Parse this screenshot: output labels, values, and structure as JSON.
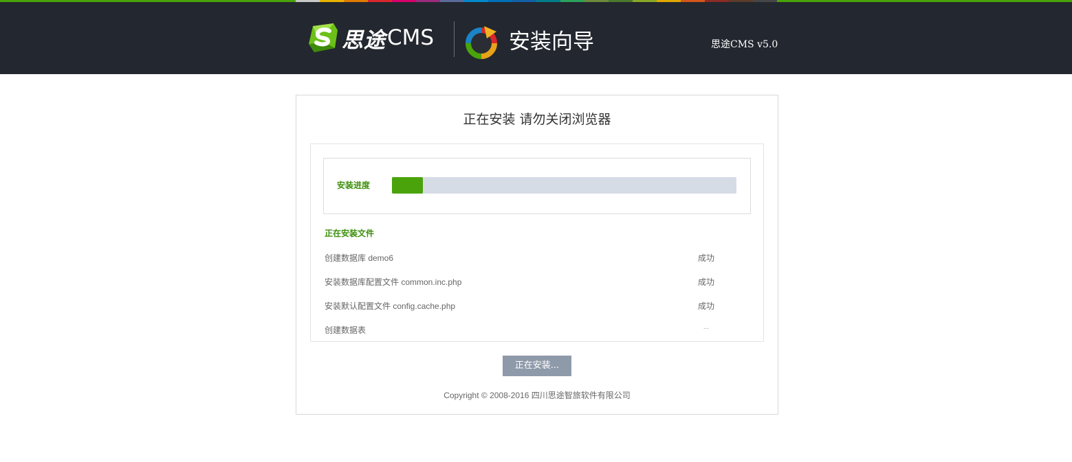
{
  "header": {
    "logo_cn": "思途",
    "logo_en": "CMS",
    "wizard_title": "安装向导",
    "version": "思途CMS v5.0",
    "brand_green": "#4aa30b",
    "bar_color": "#23272f",
    "stripe_colors": [
      "#c8c8c8",
      "#e8b400",
      "#e07b00",
      "#d9262c",
      "#d9006c",
      "#9c2a7f",
      "#5a6b9a",
      "#0088cc",
      "#0070b8",
      "#135fa8",
      "#007e8a",
      "#2ca35a",
      "#6d8a3a",
      "#4b7a2f",
      "#8aa827",
      "#e0a800",
      "#d2561b",
      "#8b2c26",
      "#5a3b2c",
      "#464646"
    ]
  },
  "main": {
    "title": "正在安装 请勿关闭浏览器",
    "progress": {
      "label": "安装进度",
      "percent": 9
    },
    "files_title": "正在安装文件",
    "steps": [
      {
        "text": "创建数据库 demo6",
        "status": "成功"
      },
      {
        "text": "安装数据库配置文件 common.inc.php",
        "status": "成功"
      },
      {
        "text": "安装默认配置文件 config.cache.php",
        "status": "成功"
      },
      {
        "text": "创建数据表",
        "status": "..."
      }
    ],
    "button_label": "正在安装...",
    "copyright": "Copyright © 2008-2016 四川思途智旅软件有限公司"
  }
}
